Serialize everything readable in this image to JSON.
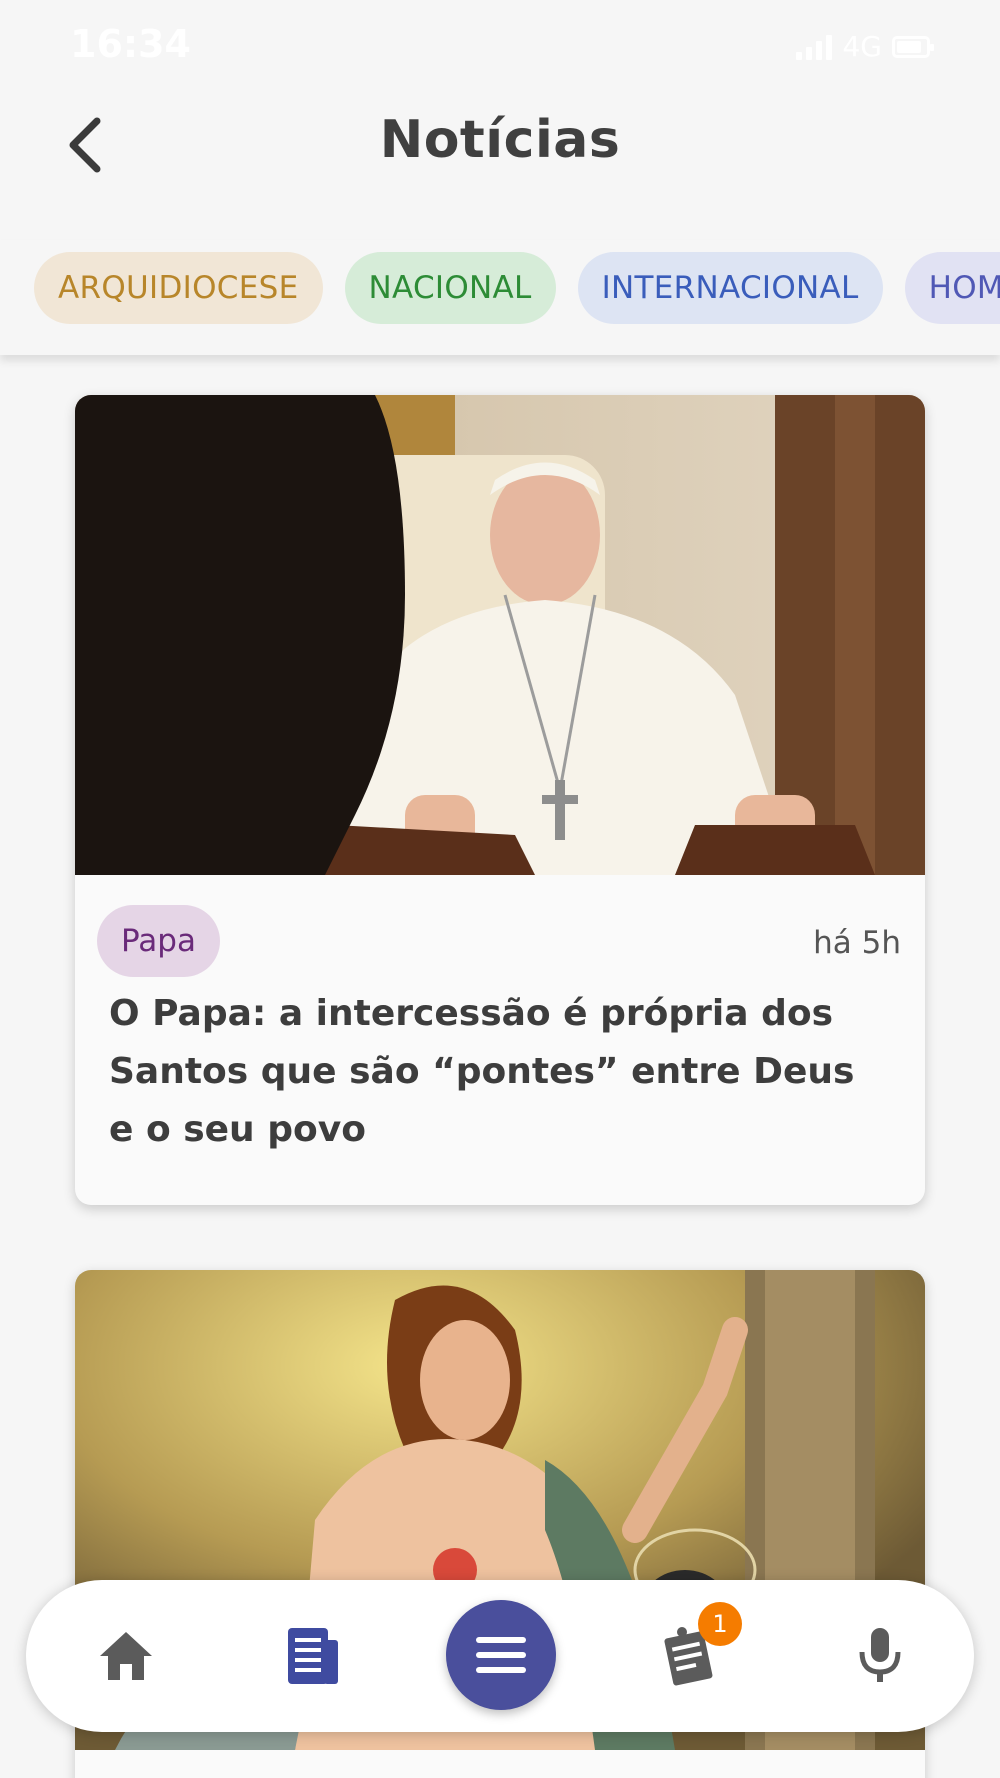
{
  "status_bar": {
    "time": "16:34",
    "network": "4G"
  },
  "header": {
    "title": "Notícias"
  },
  "chips": [
    {
      "label": "ARQUIDIOCESE"
    },
    {
      "label": "NACIONAL"
    },
    {
      "label": "INTERNACIONAL"
    },
    {
      "label": "HOMI"
    }
  ],
  "articles": [
    {
      "tag": "Papa",
      "time": "há 5h",
      "title": "O Papa: a intercessão é própria dos Santos que são “pontes” entre Deus e o seu povo"
    }
  ],
  "bottom_nav": {
    "items": [
      {
        "icon": "home-icon"
      },
      {
        "icon": "news-icon"
      },
      {
        "icon": "menu-icon"
      },
      {
        "icon": "notes-icon",
        "badge": "1"
      },
      {
        "icon": "mic-icon"
      }
    ]
  },
  "colors": {
    "accent": "#4a4f9c",
    "badge": "#f57c00",
    "chip_arquidiocese": "#f1e6d6",
    "chip_nacional": "#d6ecd8",
    "chip_internacional": "#dde4f3",
    "tag_papa": "#e5d5e6"
  }
}
